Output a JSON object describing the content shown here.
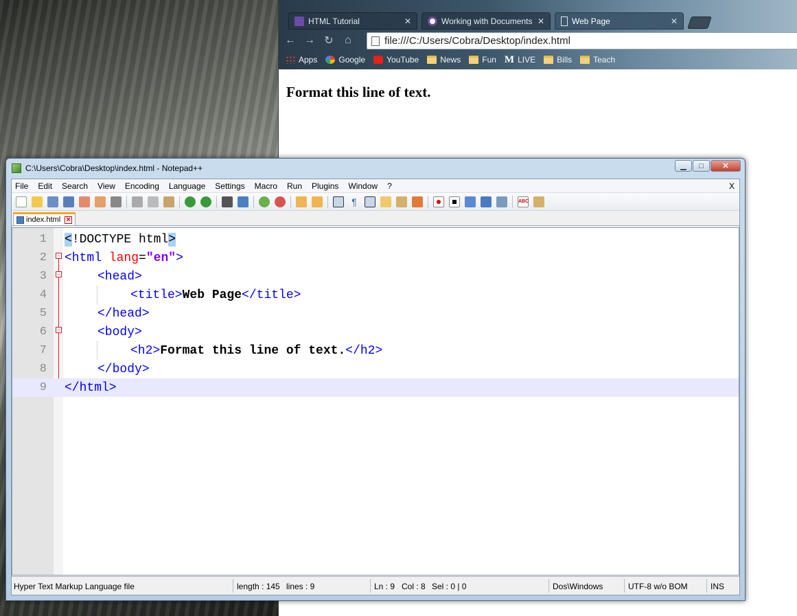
{
  "browser": {
    "tabs": [
      {
        "label": "HTML Tutorial",
        "active": false
      },
      {
        "label": "Working with Documents",
        "active": false
      },
      {
        "label": "Web Page",
        "active": true
      }
    ],
    "address": "file:///C:/Users/Cobra/Desktop/index.html",
    "bookmarks": [
      {
        "label": "Apps",
        "icon": "apps-icon"
      },
      {
        "label": "Google",
        "icon": "google-icon"
      },
      {
        "label": "YouTube",
        "icon": "youtube-icon"
      },
      {
        "label": "News",
        "icon": "folder-icon"
      },
      {
        "label": "Fun",
        "icon": "folder-icon"
      },
      {
        "label": "LIVE",
        "icon": "m-icon"
      },
      {
        "label": "Bills",
        "icon": "folder-icon"
      },
      {
        "label": "Teach",
        "icon": "folder-icon"
      }
    ],
    "m_glyph": "M",
    "page_heading": "Format this line of text."
  },
  "notepad": {
    "title": "C:\\Users\\Cobra\\Desktop\\index.html - Notepad++",
    "menu": [
      "File",
      "Edit",
      "Search",
      "View",
      "Encoding",
      "Language",
      "Settings",
      "Macro",
      "Run",
      "Plugins",
      "Window",
      "?"
    ],
    "menu_close": "X",
    "doc_tab": "index.html",
    "line_numbers": [
      "1",
      "2",
      "3",
      "4",
      "5",
      "6",
      "7",
      "8",
      "9"
    ],
    "code": {
      "l1_a": "<",
      "l1_b": "!DOCTYPE html",
      "l1_c": ">",
      "l2_open": "<html",
      "l2_attr": " lang",
      "l2_eq": "=",
      "l2_val": "\"en\"",
      "l2_close": ">",
      "l3": "<head>",
      "l4_open": "<title>",
      "l4_text": "Web Page",
      "l4_close": "</title>",
      "l5": "</head>",
      "l6": "<body>",
      "l7_open": "<h2>",
      "l7_text": "Format this line of text.",
      "l7_close": "</h2>",
      "l8": "</body>",
      "l9": "</html>"
    },
    "status": {
      "filetype": "Hyper Text Markup Language file",
      "length": "length : 145",
      "lines": "lines : 9",
      "ln": "Ln : 9",
      "col": "Col : 8",
      "sel": "Sel : 0 | 0",
      "eol": "Dos\\Windows",
      "encoding": "UTF-8 w/o BOM",
      "mode": "INS"
    }
  }
}
